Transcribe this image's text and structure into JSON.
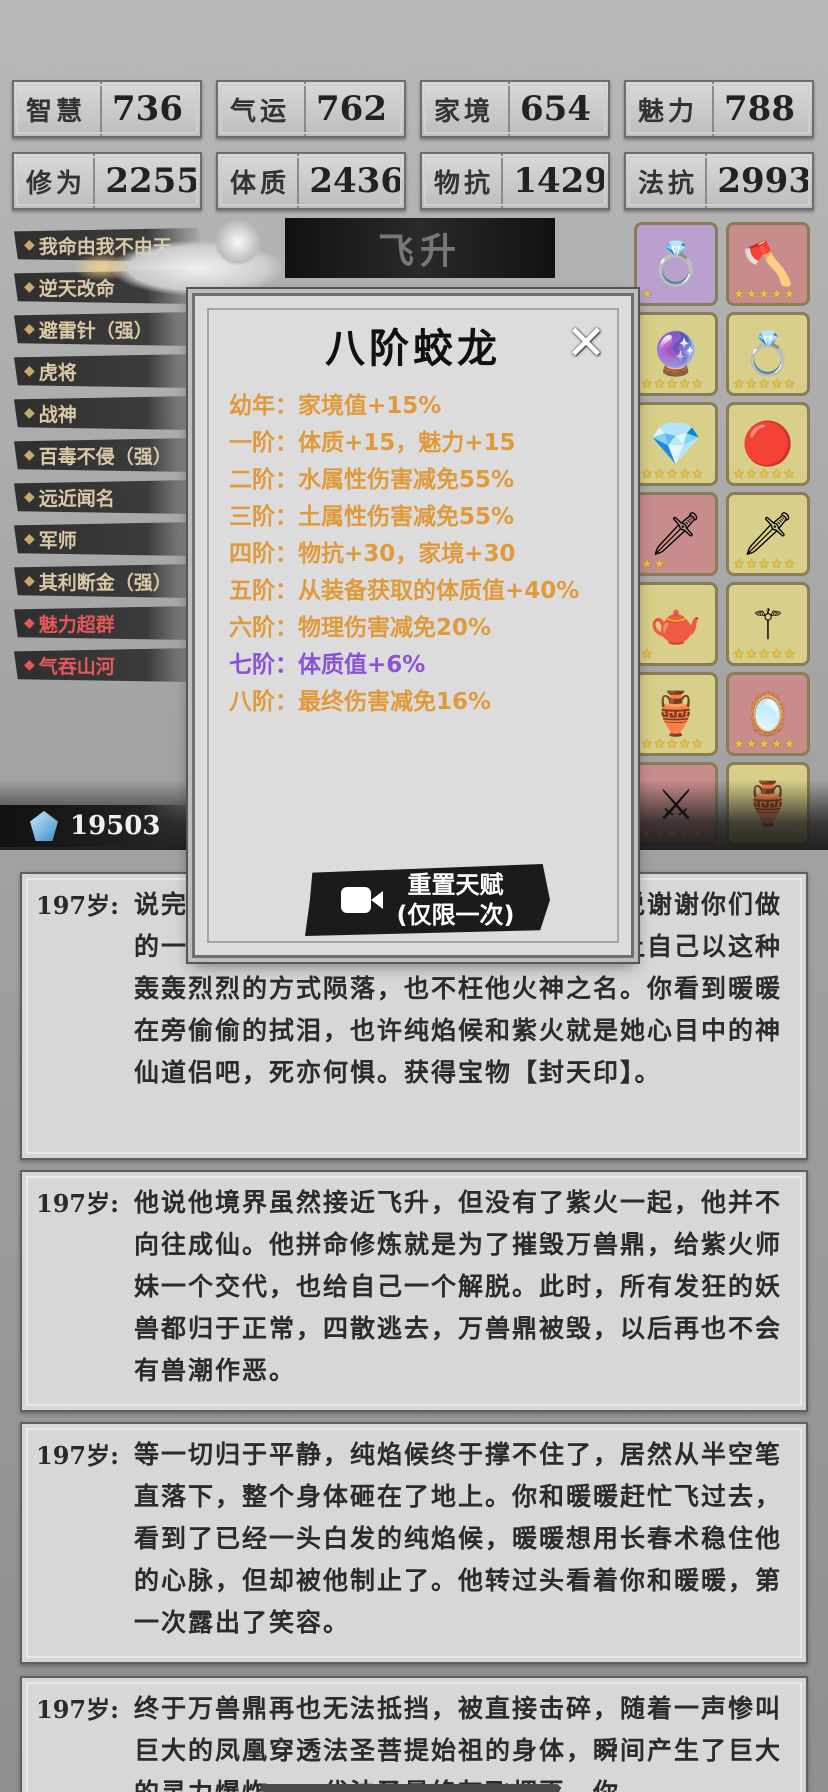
{
  "stats": [
    {
      "label": "智慧",
      "value": "736"
    },
    {
      "label": "气运",
      "value": "762"
    },
    {
      "label": "家境",
      "value": "654"
    },
    {
      "label": "魅力",
      "value": "788"
    },
    {
      "label": "修为",
      "value": "2255"
    },
    {
      "label": "体质",
      "value": "2436"
    },
    {
      "label": "物抗",
      "value": "1429"
    },
    {
      "label": "法抗",
      "value": "2993"
    }
  ],
  "talents": [
    {
      "label": "我命由我不由天",
      "red": false
    },
    {
      "label": "逆天改命",
      "red": false
    },
    {
      "label": "避雷针（强）",
      "red": false
    },
    {
      "label": "虎将",
      "red": false
    },
    {
      "label": "战神",
      "red": false
    },
    {
      "label": "百毒不侵（强）",
      "red": false
    },
    {
      "label": "远近闻名",
      "red": false
    },
    {
      "label": "军师",
      "red": false
    },
    {
      "label": "其利断金（强）",
      "red": false
    },
    {
      "label": "魅力超群",
      "red": true
    },
    {
      "label": "气吞山河",
      "red": true
    }
  ],
  "banner_title": "飞升",
  "items": [
    {
      "icon": "ring-icon",
      "glyph": "💍",
      "color": "purple",
      "stars": "★"
    },
    {
      "icon": "axe-icon",
      "glyph": "🪓",
      "color": "red",
      "stars": "★★★★★"
    },
    {
      "icon": "orb-icon",
      "glyph": "🔮",
      "color": "yellow",
      "stars": "★★★★★"
    },
    {
      "icon": "ruby-ring-icon",
      "glyph": "💍",
      "color": "yellow",
      "stars": "★★★★★"
    },
    {
      "icon": "crystal-icon",
      "glyph": "💎",
      "color": "yellow",
      "stars": "★★★★★"
    },
    {
      "icon": "fire-orb-icon",
      "glyph": "🔴",
      "color": "yellow",
      "stars": "★★★★★"
    },
    {
      "icon": "sword-icon",
      "glyph": "🗡",
      "color": "red",
      "stars": "★★"
    },
    {
      "icon": "dagger-icon",
      "glyph": "🗡",
      "color": "yellow",
      "stars": "★★★★★"
    },
    {
      "icon": "teapot-icon",
      "glyph": "🫖",
      "color": "yellow",
      "stars": "★"
    },
    {
      "icon": "staff-icon",
      "glyph": "⚚",
      "color": "yellow",
      "stars": "★★★★★"
    },
    {
      "icon": "bowl-icon",
      "glyph": "🏺",
      "color": "yellow",
      "stars": "★★★★★"
    },
    {
      "icon": "mirror-icon",
      "glyph": "🪞",
      "color": "red",
      "stars": "★★★★★"
    },
    {
      "icon": "blade-icon",
      "glyph": "⚔",
      "color": "red",
      "stars": "★★★★★"
    },
    {
      "icon": "cauldron-icon",
      "glyph": "🏺",
      "color": "yellow",
      "stars": "★★★★★"
    }
  ],
  "currency": {
    "value": "19503",
    "icon": "crystal-gem-icon"
  },
  "entries": [
    {
      "age": "197岁:",
      "text": "说完，纯焰候便头也不回冲向了万兽鼎。说谢谢你们做的一切，这一次他终于可以真正地释放，让自己以这种轰轰烈烈的方式陨落，也不枉他火神之名。你看到暖暖在旁偷偷的拭泪，也许纯焰候和紫火就是她心目中的神仙道侣吧，死亦何惧。获得宝物【封天印】。"
    },
    {
      "age": "197岁:",
      "text": "他说他境界虽然接近飞升，但没有了紫火一起，他并不向往成仙。他拼命修炼就是为了摧毁万兽鼎，给紫火师妹一个交代，也给自己一个解脱。此时，所有发狂的妖兽都归于正常，四散逃去，万兽鼎被毁，以后再也不会有兽潮作恶。"
    },
    {
      "age": "197岁:",
      "text": "等一切归于平静，纯焰候终于撑不住了，居然从半空笔直落下，整个身体砸在了地上。你和暖暖赶忙飞过去，看到了已经一头白发的纯焰候，暖暖想用长春术稳住他的心脉，但却被他制止了。他转过头看着你和暖暖，第一次露出了笑容。"
    },
    {
      "age": "197岁:",
      "text": "终于万兽鼎再也无法抵挡，被直接击碎，随着一声惨叫巨大的凤凰穿透法圣菩提始祖的身体，瞬间产生了巨大的灵力爆炸，一代法圣最终灰飞烟灭。你"
    }
  ],
  "modal": {
    "title": "八阶蛟龙",
    "close_icon": "close-icon",
    "levels": [
      {
        "text": "幼年：家境值+15%",
        "purple": false
      },
      {
        "text": "一阶：体质+15，魅力+15",
        "purple": false
      },
      {
        "text": "二阶：水属性伤害减免55%",
        "purple": false
      },
      {
        "text": "三阶：土属性伤害减免55%",
        "purple": false
      },
      {
        "text": "四阶：物抗+30，家境+30",
        "purple": false
      },
      {
        "text": "五阶：从装备获取的体质值+40%",
        "purple": false
      },
      {
        "text": "六阶：物理伤害减免20%",
        "purple": false
      },
      {
        "text": "七阶：体质值+6%",
        "purple": true
      },
      {
        "text": "八阶：最终伤害减免16%",
        "purple": false
      }
    ],
    "reset_line1": "重置天赋",
    "reset_line2": "(仅限一次)"
  },
  "colors": {
    "level_orange": "#e19a3b",
    "level_purple": "#8b52d8",
    "talent_red": "#e45858"
  }
}
